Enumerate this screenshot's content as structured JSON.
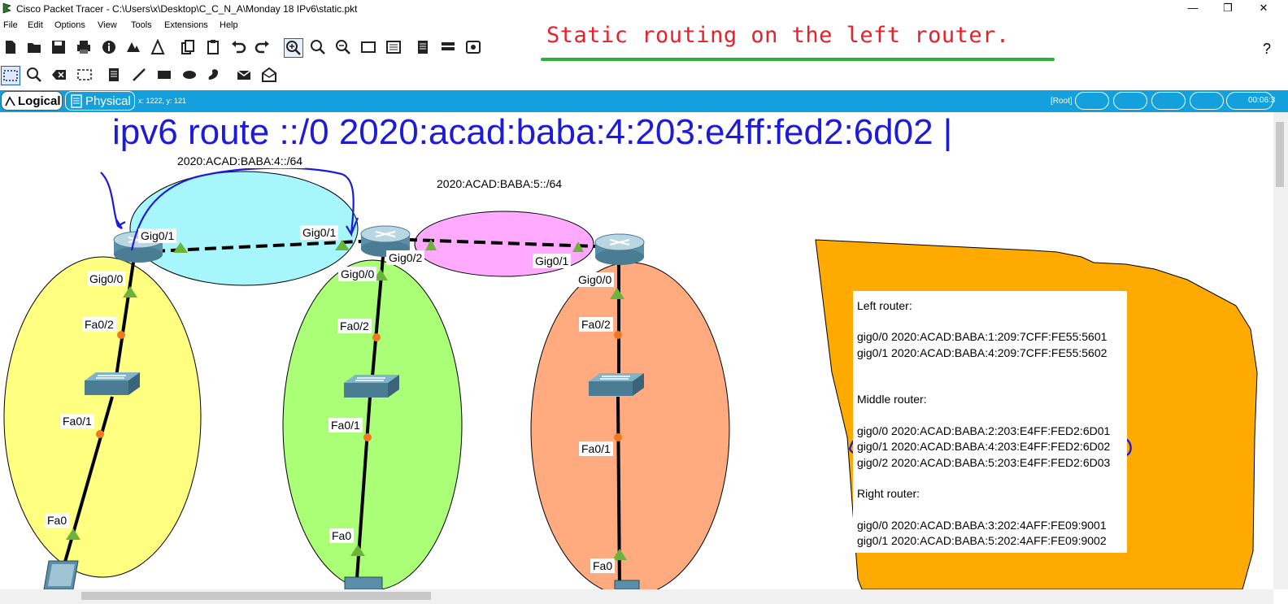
{
  "window": {
    "title": "Cisco Packet Tracer - C:\\Users\\x\\Desktop\\C_C_N_A\\Monday 18 IPv6\\static.pkt",
    "minimize": "—",
    "maximize": "❐",
    "close": "✕"
  },
  "menu": [
    "File",
    "Edit",
    "Options",
    "View",
    "Tools",
    "Extensions",
    "Help"
  ],
  "annotation": {
    "title": "Static routing on the left router.",
    "command": "ipv6 route  ::/0  2020:acad:baba:4:203:e4ff:fed2:6d02  |"
  },
  "help_symbol": "?",
  "modebar": {
    "logical": "Logical",
    "physical": "Physical",
    "coords": "x: 1222, y: 121",
    "root": "[Root]",
    "time": "00:06:3"
  },
  "network": {
    "net_left_label": "2020:ACAD:BABA:4::/64",
    "net_right_label": "2020:ACAD:BABA:5::/64",
    "left_router": {
      "gig01": "Gig0/1",
      "gig00": "Gig0/0"
    },
    "middle_router": {
      "gig01": "Gig0/1",
      "gig02": "Gig0/2",
      "gig00": "Gig0/0"
    },
    "right_router": {
      "gig01": "Gig0/1",
      "gig00": "Gig0/0"
    },
    "left_switch": {
      "fa02": "Fa0/2",
      "fa01": "Fa0/1",
      "pc_fa0": "Fa0"
    },
    "middle_switch": {
      "fa02": "Fa0/2",
      "fa01": "Fa0/1",
      "pc_fa0": "Fa0"
    },
    "right_switch": {
      "fa02": "Fa0/2",
      "fa01": "Fa0/1",
      "pc_fa0": "Fa0"
    }
  },
  "notes": {
    "left_title": "Left router:",
    "left_g00": "gig0/0 2020:ACAD:BABA:1:209:7CFF:FE55:5601",
    "left_g01": "gig0/1 2020:ACAD:BABA:4:209:7CFF:FE55:5602",
    "middle_title": "Middle router:",
    "middle_g00": "gig0/0 2020:ACAD:BABA:2:203:E4FF:FED2:6D01",
    "middle_g01": "gig0/1 2020:ACAD:BABA:4:203:E4FF:FED2:6D02",
    "middle_g02": "gig0/2 2020:ACAD:BABA:5:203:E4FF:FED2:6D03",
    "right_title": "Right router:",
    "right_g00": "gig0/0 2020:ACAD:BABA:3:202:4AFF:FE09:9001",
    "right_g01": "gig0/1 2020:ACAD:BABA:5:202:4AFF:FE09:9002"
  },
  "colors": {
    "modebar": "#13a0dd",
    "annotation_red": "#e8202a",
    "annotation_blue": "#1d1ad8",
    "underline_green": "#2eae3a",
    "cloud_cyan": "#a6f6fb",
    "cloud_pink": "#ffaaff",
    "ellipse_yellow": "#ffff80",
    "ellipse_green": "#aaff77",
    "ellipse_salmon": "#ffaa7f",
    "note_orange": "#ffaa00"
  }
}
